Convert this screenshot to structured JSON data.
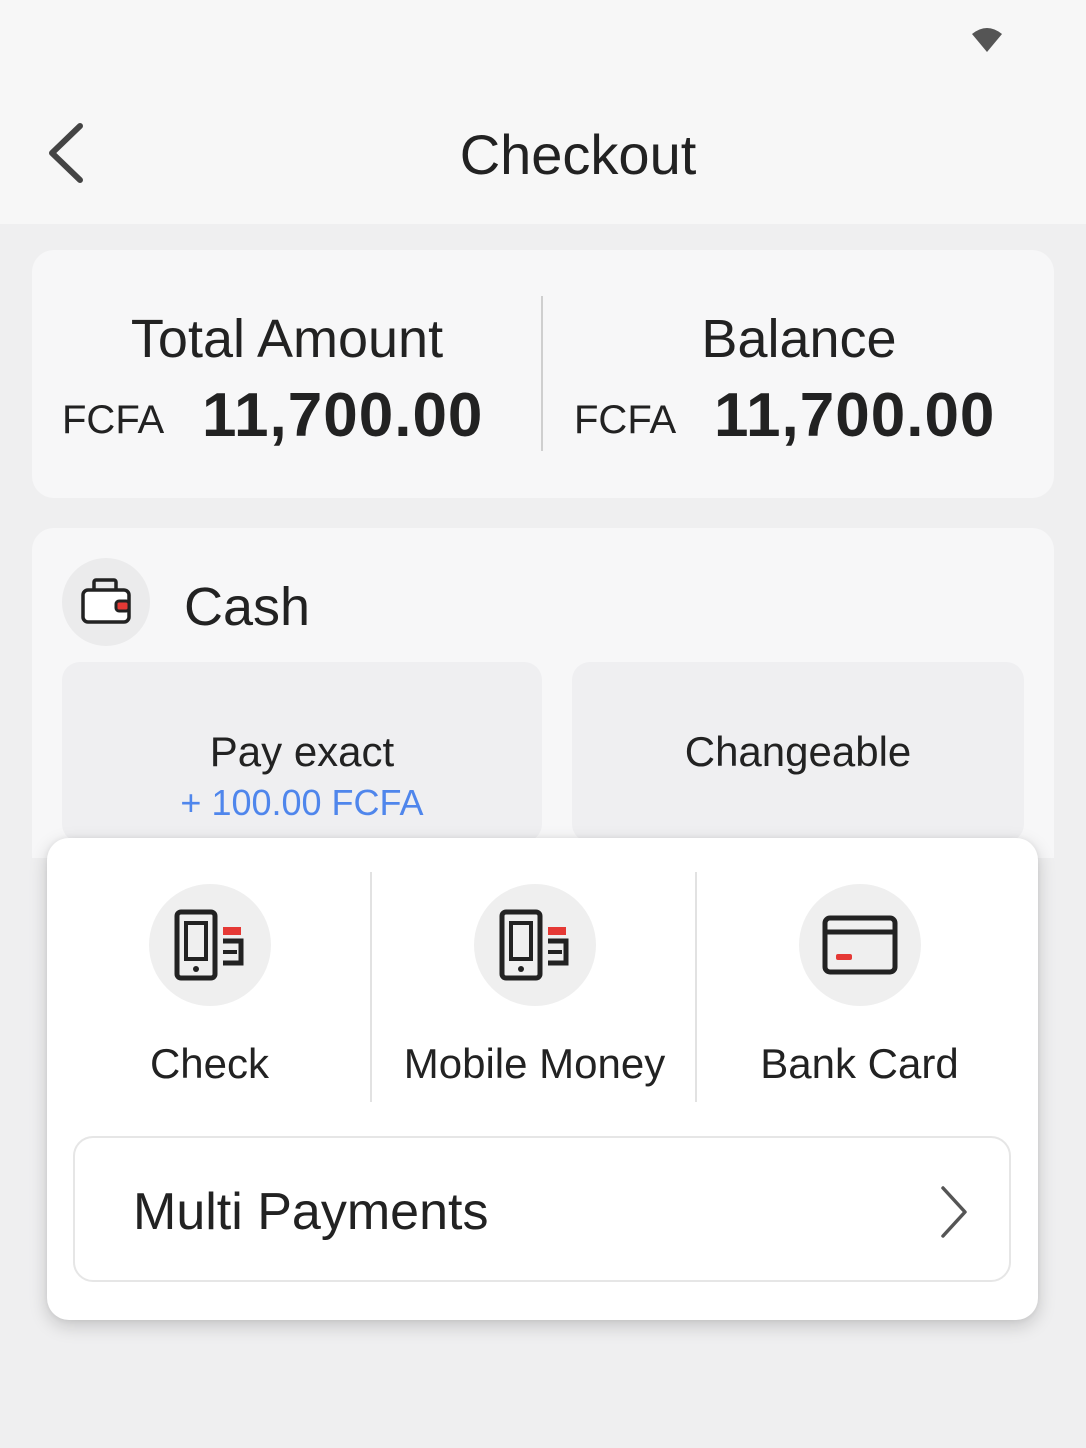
{
  "header": {
    "title": "Checkout"
  },
  "totals": {
    "total_label": "Total Amount",
    "total_currency": "FCFA",
    "total_value": "11,700.00",
    "balance_label": "Balance",
    "balance_currency": "FCFA",
    "balance_value": "11,700.00"
  },
  "cash": {
    "title": "Cash",
    "icon": "wallet-icon",
    "pay_exact_label": "Pay exact",
    "pay_exact_sub": "+ 100.00 FCFA",
    "changeable_label": "Changeable"
  },
  "methods": [
    {
      "label": "Check",
      "icon": "phone-pay-icon"
    },
    {
      "label": "Mobile Money",
      "icon": "phone-pay-icon"
    },
    {
      "label": "Bank Card",
      "icon": "card-icon"
    }
  ],
  "multi": {
    "label": "Multi Payments"
  },
  "colors": {
    "accent_blue": "#4f86ec",
    "icon_red": "#e53935"
  }
}
